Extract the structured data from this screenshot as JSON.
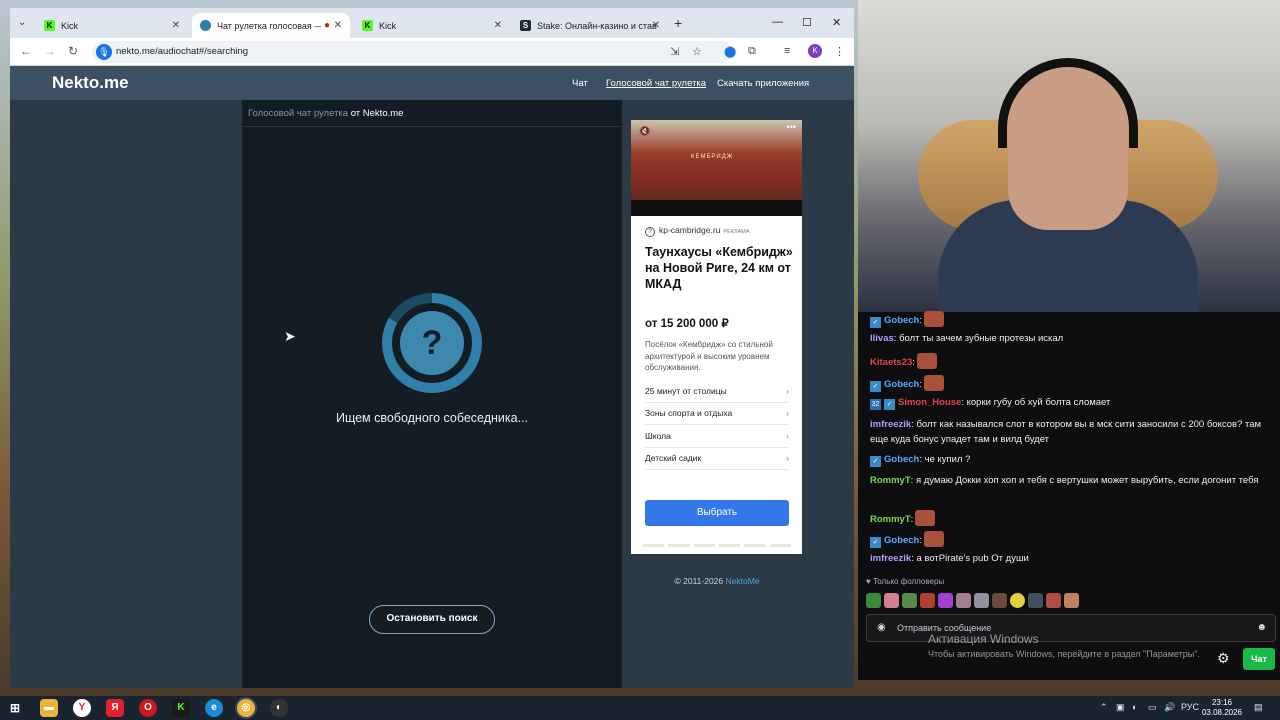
{
  "browser": {
    "tabs": [
      {
        "title": "Kick",
        "favicon": "kick-icon",
        "color": "#53fc18"
      },
      {
        "title": "Чат рулетка голосовая — ",
        "favicon": "nekto-icon",
        "color": "#2f7fa8",
        "recording": "●"
      },
      {
        "title": "Kick",
        "favicon": "kick-icon",
        "color": "#53fc18"
      },
      {
        "title": "Stake: Онлайн-казино и ставки",
        "favicon": "stake-icon",
        "color": "#1a2c38"
      }
    ],
    "new_tab": "+",
    "url": "nekto.me/audiochat#/searching",
    "profile_initial": "K",
    "window_controls": {
      "minimize": "—",
      "maximize": "☐",
      "close": "✕"
    }
  },
  "site": {
    "logo": "Nekto.me",
    "nav": [
      "Чат",
      "Голосовой чат рулетка",
      "Скачать приложения"
    ],
    "breadcrumb": {
      "link": "Голосовой чат рулетка",
      "suffix": " от Nekto.me"
    },
    "status": "Ищем свободного собеседника...",
    "spinner_glyph": "?",
    "stop_button": "Остановить поиск",
    "copyright": "© 2011-2026 ",
    "copyright_link": "NektoMe"
  },
  "ad": {
    "image_label": "КЕМБРИДЖ",
    "domain": "kp-cambridge.ru",
    "tag": "РЕКЛАМА",
    "title": "Таунхаусы «Кембридж» на Новой Риге, 24 км от МКАД",
    "price": "от 15 200 000 ₽",
    "description": "Посёлок «Кембридж» со стильной архитектурой и высоким уровнем обслуживания.",
    "rows": [
      "25 минут от столицы",
      "Зоны спорта и отдыха",
      "Школа",
      "Детский садик"
    ],
    "cta": "Выбрать"
  },
  "chat": {
    "messages": [
      {
        "user": "Gobech",
        "color": "#5aa9ff",
        "text": "",
        "emote": true
      },
      {
        "user": "llivas",
        "color": "#b69bff",
        "text": "болт ты зачем зубные протезы искал"
      },
      {
        "user": "Kitaets23",
        "color": "#e0464e",
        "text": "",
        "emote": true
      },
      {
        "user": "Gobech",
        "color": "#5aa9ff",
        "text": "",
        "emote": true
      },
      {
        "user": "Simon_House",
        "color": "#e0464e",
        "text": "корки губу об хуй болта сломает"
      },
      {
        "user": "imfreezik",
        "color": "#b69bff",
        "text": "болт как назывался слот в котором вы в мск сити заносили с 200 боксов? там еще куда бонус упадет там и вилд будет"
      },
      {
        "user": "Gobech",
        "color": "#5aa9ff",
        "text": "че купил ?"
      },
      {
        "user": "RommyT",
        "color": "#7cd65a",
        "text": "я думаю Докки хоп хоп и тебя с вертушки может вырубить, если догонит тебя"
      },
      {
        "user": "RommyT",
        "color": "#7cd65a",
        "text": "",
        "emote": true
      },
      {
        "user": "Gobech",
        "color": "#5aa9ff",
        "text": "",
        "emote": true
      },
      {
        "user": "imfreezik",
        "color": "#b69bff",
        "text": "а вотPirate's pub От души"
      }
    ],
    "sub_badge": "32",
    "followers_only": "Только фолловеры",
    "input_placeholder": "Отправить сообщение",
    "send_button": "Чат",
    "watermark_title": "Активация Windows",
    "watermark_text": "Чтобы активировать Windows, перейдите в раздел \"Параметры\"."
  },
  "taskbar": {
    "language": "РУС",
    "time": "23:16",
    "date": "03.08.2026"
  }
}
